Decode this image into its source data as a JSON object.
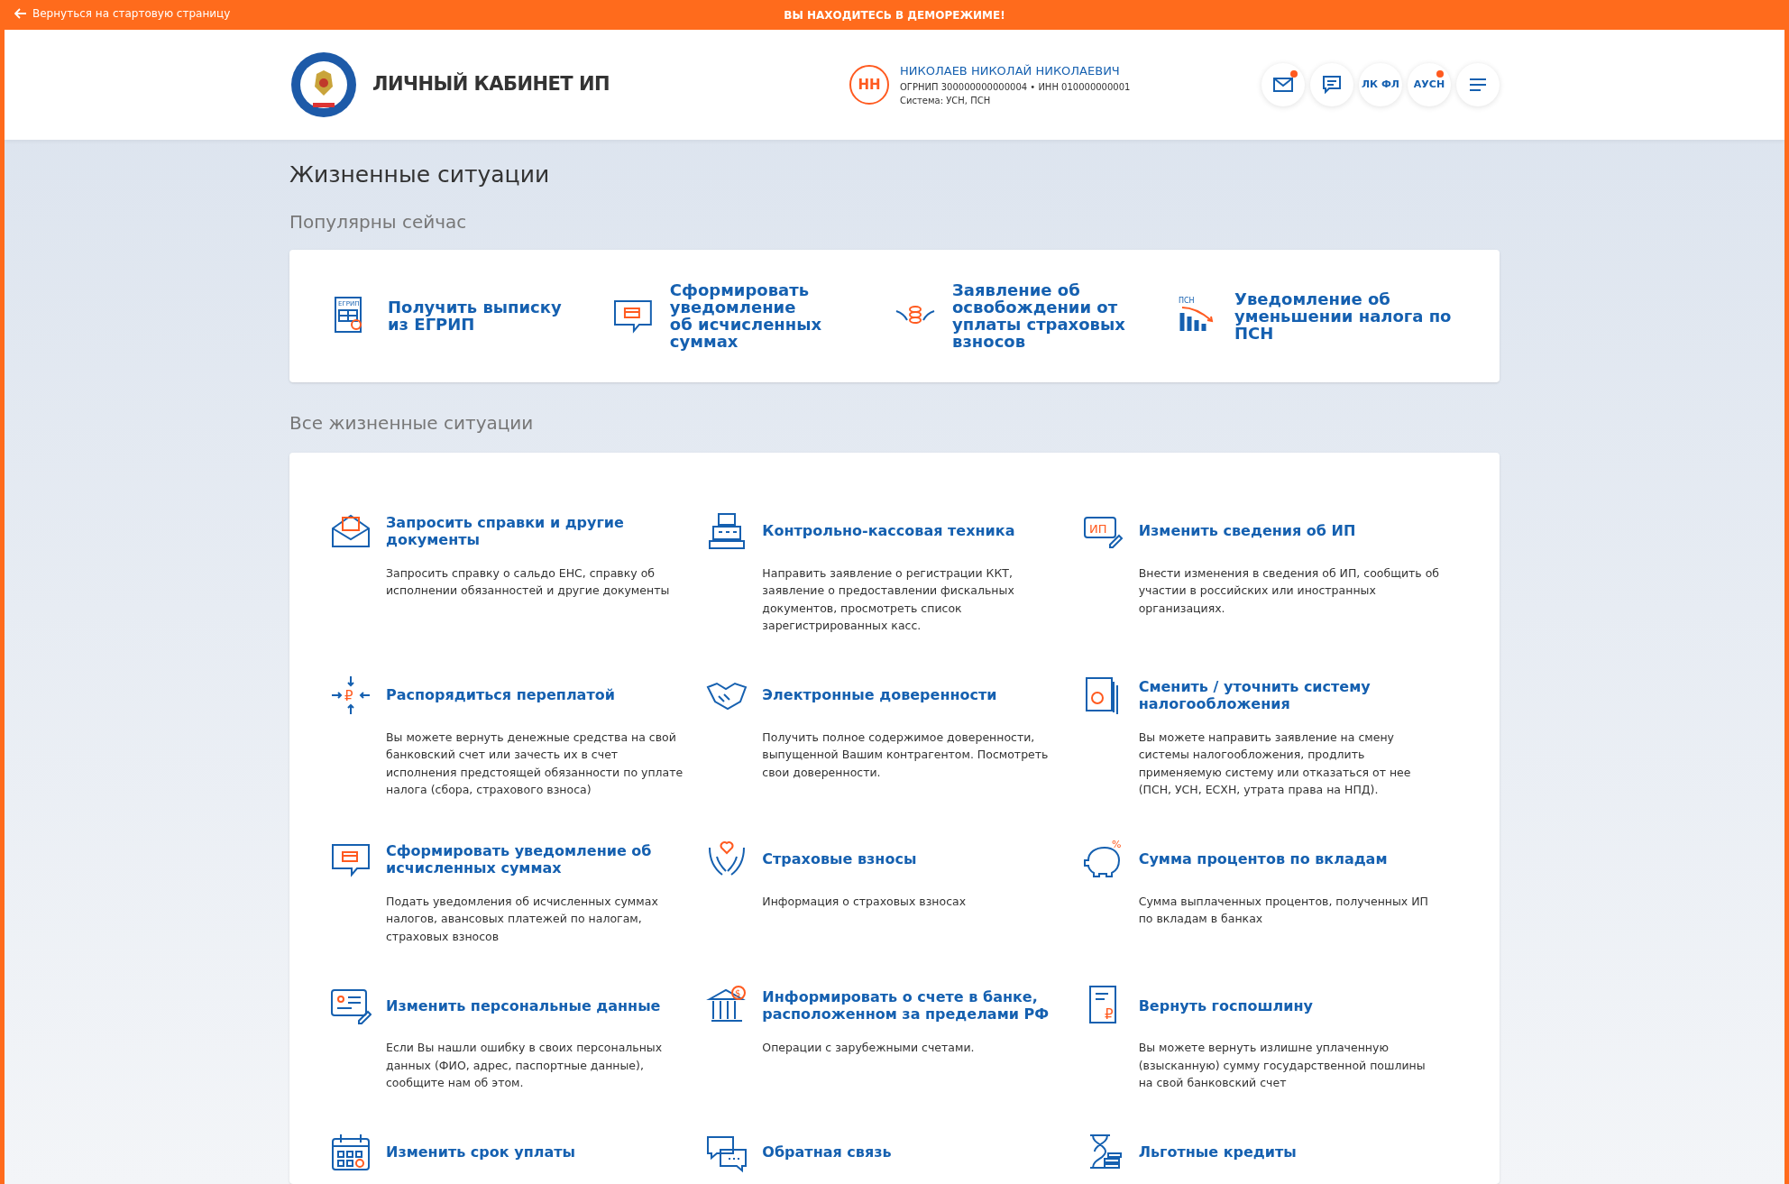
{
  "demo_bar": {
    "back_link": "Вернуться на стартовую страницу",
    "notice": "ВЫ НАХОДИТЕСЬ В ДЕМОРЕЖИМЕ!"
  },
  "header": {
    "title": "ЛИЧНЫЙ КАБИНЕТ ИП",
    "user": {
      "initials": "НН",
      "name": "НИКОЛАЕВ НИКОЛАЙ НИКОЛАЕВИЧ",
      "ogrnip": "ОГРНИП 300000000000004",
      "separator": "•",
      "inn": "ИНН 010000000001",
      "system": "Система: УСН, ПСН"
    },
    "actions": [
      {
        "kind": "mail",
        "has_notification": true
      },
      {
        "kind": "chat",
        "has_notification": false
      },
      {
        "kind": "text",
        "label": "ЛК ФЛ",
        "has_notification": false
      },
      {
        "kind": "text",
        "label": "АУСН",
        "has_notification": true
      },
      {
        "kind": "menu",
        "has_notification": false
      }
    ]
  },
  "page_title": "Жизненные ситуации",
  "popular_heading": "Популярны сейчас",
  "popular": [
    {
      "title": "Получить выписку\nиз ЕГРИП",
      "icon_text": "ЕГРИП"
    },
    {
      "title": "Сформировать\nуведомление\nоб исчисленных суммах"
    },
    {
      "title": "Заявление об\nосвобождении от\nуплаты страховых\nвзносов"
    },
    {
      "title": "Уведомление об\nуменьшении налога по\nПСН",
      "icon_text": "ПСН"
    }
  ],
  "all_heading": "Все жизненные ситуации",
  "situations": [
    {
      "title": "Запросить справки и другие\nдокументы",
      "description": "Запросить справку о сальдо ЕНС, справку об исполнении обязанностей и другие документы"
    },
    {
      "title": "Контрольно-кассовая техника",
      "description": "Направить заявление о регистрации ККТ, заявление о предоставлении фискальных документов, просмотреть список зарегистрированных касс."
    },
    {
      "title": "Изменить сведения об ИП",
      "description": "Внести изменения в сведения об ИП, сообщить об участии в российских или иностранных организациях.",
      "icon_text": "ИП"
    },
    {
      "title": "Распорядиться переплатой",
      "description": "Вы можете вернуть денежные средства на свой банковский счет или зачесть их в счет исполнения предстоящей обязанности по уплате налога (сбора, страхового взноса)",
      "icon_text": "₽"
    },
    {
      "title": "Электронные доверенности",
      "description": "Получить полное содержимое доверенности, выпущенной Вашим контрагентом. Посмотреть свои доверенности."
    },
    {
      "title": "Сменить / уточнить систему\nналогообложения",
      "description": "Вы можете направить заявление на смену системы налогообложения, продлить применяемую систему или отказаться от нее (ПСН, УСН, ЕСХН, утрата права на НПД)."
    },
    {
      "title": "Сформировать уведомление об\nисчисленных суммах",
      "description": "Подать уведомления об исчисленных суммах налогов, авансовых платежей по налогам, страховых взносов"
    },
    {
      "title": "Страховые взносы",
      "description": "Информация о страховых взносах"
    },
    {
      "title": "Сумма процентов по вкладам",
      "description": "Сумма выплаченных процентов, полученных ИП по вкладам в банках",
      "icon_text": "%"
    },
    {
      "title": "Изменить персональные данные",
      "description": "Если Вы нашли ошибку в своих персональных данных (ФИО, адрес, паспортные данные), сообщите нам об этом."
    },
    {
      "title": "Информировать о счете в банке,\nрасположенном за пределами РФ",
      "description": "Операции с зарубежными счетами.",
      "icon_text": "$"
    },
    {
      "title": "Вернуть госпошлину",
      "description": "Вы можете вернуть излишне уплаченную (взысканную) сумму государственной пошлины на свой банковский счет",
      "icon_text": "₽"
    },
    {
      "title": "Изменить срок уплаты"
    },
    {
      "title": "Обратная связь"
    },
    {
      "title": "Льготные кредиты"
    }
  ]
}
